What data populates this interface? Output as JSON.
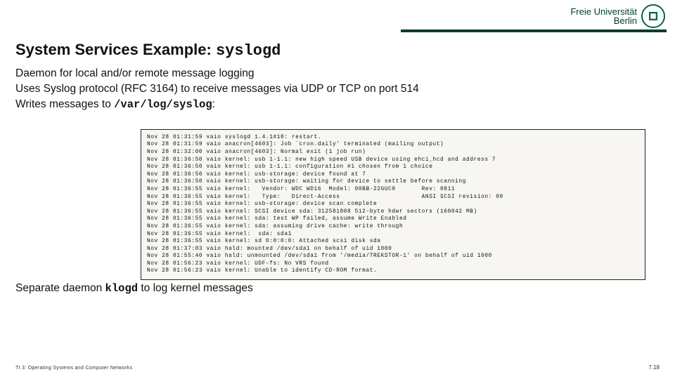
{
  "header": {
    "uni_line1": "Freie Universität",
    "uni_line2": "Berlin"
  },
  "title": {
    "pre": "System Services Example: ",
    "code": "syslogd"
  },
  "desc": {
    "l1": "Daemon for local and/or remote message logging",
    "l2": "Uses Syslog protocol (RFC 3164) to receive messages via UDP or TCP on port 514",
    "l3a": "Writes messages to ",
    "l3code": "/var/log/syslog",
    "l3b": ":"
  },
  "log_lines": [
    "Nov 28 01:31:59 vaio syslogd 1.4.1#18: restart.",
    "Nov 28 01:31:59 vaio anacron[4603]: Job `cron.daily' terminated (mailing output)",
    "Nov 28 01:32:00 vaio anacron[4603]: Normal exit (1 job run)",
    "Nov 28 01:36:50 vaio kernel: usb 1-1.1: new high speed USB device using ehci_hcd and address 7",
    "Nov 28 01:36:50 vaio kernel: usb 1-1.1: configuration #1 chosen from 1 choice",
    "Nov 28 01:36:50 vaio kernel: usb-storage: device found at 7",
    "Nov 28 01:36:50 vaio kernel: usb-storage: waiting for device to settle before scanning",
    "Nov 28 01:36:55 vaio kernel:   Vendor: WDC WD16  Model: 00BB-22GUC0       Rev: 0811",
    "Nov 28 01:36:55 vaio kernel:   Type:   Direct-Access                      ANSI SCSI revision: 00",
    "Nov 28 01:36:55 vaio kernel: usb-storage: device scan complete",
    "Nov 28 01:36:55 vaio kernel: SCSI device sda: 312581808 512-byte hdwr sectors (160042 MB)",
    "Nov 28 01:36:55 vaio kernel: sda: test WP failed, assume Write Enabled",
    "Nov 28 01:36:55 vaio kernel: sda: assuming drive cache: write through",
    "Nov 28 01:36:55 vaio kernel:  sda: sda1",
    "Nov 28 01:36:55 vaio kernel: sd 0:0:0:0: Attached scsi disk sda",
    "Nov 28 01:37:03 vaio hald: mounted /dev/sda1 on behalf of uid 1000",
    "Nov 28 01:55:40 vaio hald: unmounted /dev/sda1 from '/media/TREKSTOR-1' on behalf of uid 1000",
    "Nov 28 01:56:23 vaio kernel: UDF-fs: No VRS found",
    "Nov 28 01:56:23 vaio kernel: Unable to identify CD-ROM format."
  ],
  "sep": {
    "pre": "Separate daemon ",
    "code": "klogd",
    "post": " to log kernel messages"
  },
  "footer": {
    "left": "TI 3: Operating Systems and Computer Networks",
    "right": "7.18"
  }
}
